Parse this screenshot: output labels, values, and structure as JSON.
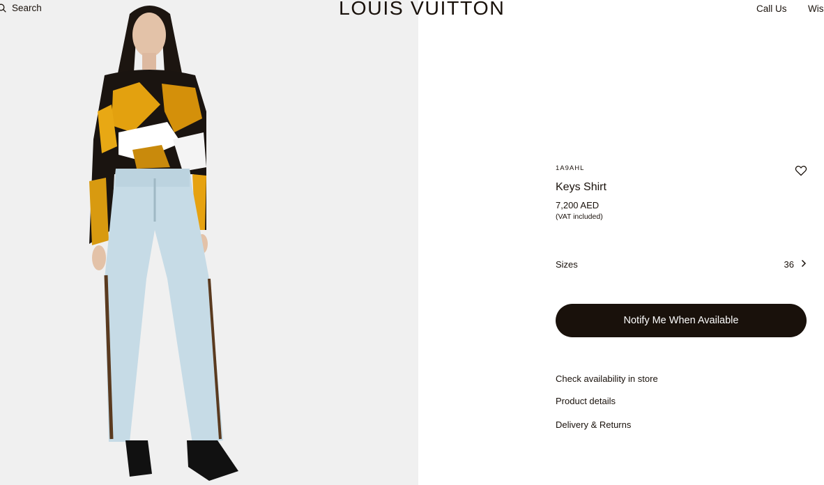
{
  "header": {
    "search_label": "Search",
    "logo": "LOUIS VUITTON",
    "call_us": "Call Us",
    "wishlist": "Wis"
  },
  "product": {
    "sku": "1A9AHL",
    "name": "Keys Shirt",
    "price": "7,200 AED",
    "vat_note": "(VAT included)",
    "sizes_label": "Sizes",
    "selected_size": "36",
    "notify_button": "Notify Me When Available",
    "links": [
      "Check availability in store",
      "Product details",
      "Delivery & Returns"
    ]
  },
  "icons": {
    "search": "search-icon",
    "wishlist": "heart-icon",
    "sizes_chevron": "chevron-right-icon"
  },
  "colors": {
    "brand_dark": "#19110b",
    "photo_background": "#f0f0f0"
  }
}
